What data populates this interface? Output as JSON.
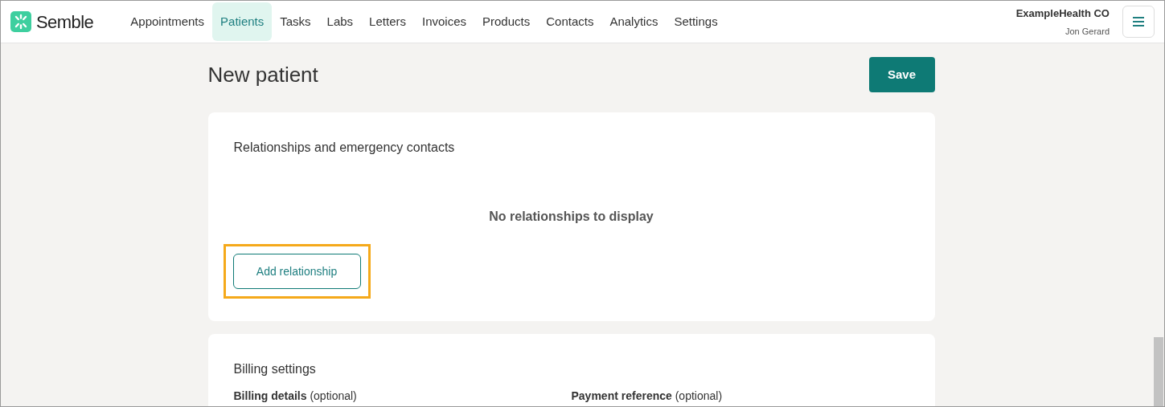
{
  "logo": {
    "text": "Semble"
  },
  "nav": [
    {
      "label": "Appointments",
      "selected": false
    },
    {
      "label": "Patients",
      "selected": true
    },
    {
      "label": "Tasks",
      "selected": false
    },
    {
      "label": "Labs",
      "selected": false
    },
    {
      "label": "Letters",
      "selected": false
    },
    {
      "label": "Invoices",
      "selected": false
    },
    {
      "label": "Products",
      "selected": false
    },
    {
      "label": "Contacts",
      "selected": false
    },
    {
      "label": "Analytics",
      "selected": false
    },
    {
      "label": "Settings",
      "selected": false
    }
  ],
  "account": {
    "organisation": "ExampleHealth CO",
    "user": "Jon Gerard"
  },
  "page": {
    "title": "New patient",
    "save_button": "Save"
  },
  "relationships": {
    "title": "Relationships and emergency contacts",
    "empty_message": "No relationships to display",
    "add_button": "Add relationship",
    "highlighted": true
  },
  "billing": {
    "title": "Billing settings",
    "fields": [
      "**Billing details** (optional)",
      "**Payment reference** (optional)"
    ]
  }
}
